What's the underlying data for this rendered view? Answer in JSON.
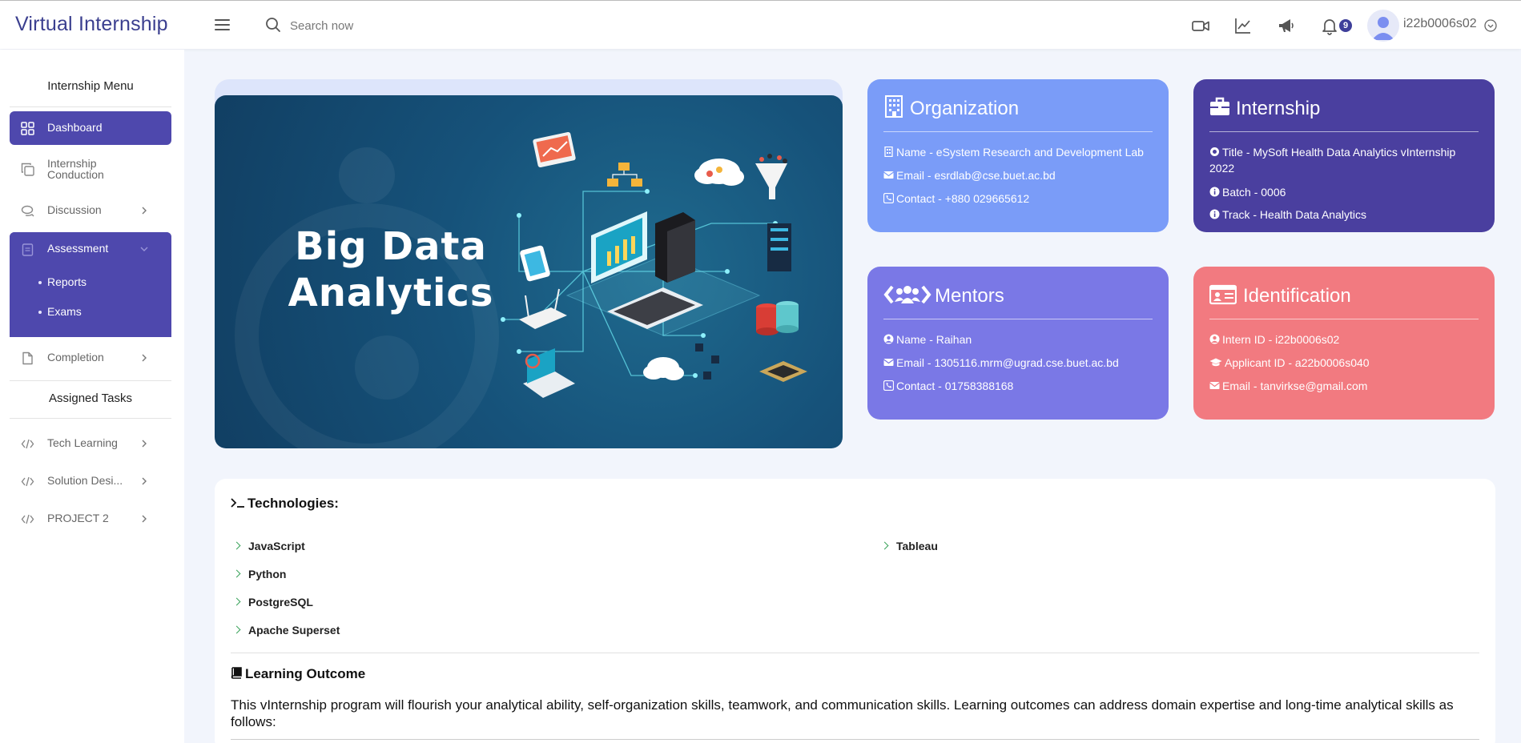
{
  "header": {
    "brand": "Virtual Internship",
    "search_placeholder": "Search now",
    "notification_count": "9",
    "username": "i22b0006s02",
    "icons": [
      "video-icon",
      "trend-chart-icon",
      "megaphone-icon",
      "bell-icon"
    ]
  },
  "sidebar": {
    "heading_menu": "Internship Menu",
    "heading_tasks": "Assigned Tasks",
    "items": [
      {
        "label": "Dashboard",
        "icon": "grid-icon"
      },
      {
        "label": "Internship Conduction",
        "icon": "copy-icon"
      },
      {
        "label": "Discussion",
        "icon": "chat-icon"
      },
      {
        "label": "Assessment",
        "icon": "clipboard-icon"
      },
      {
        "label": "Completion",
        "icon": "file-icon"
      }
    ],
    "assessment_sub": [
      "Reports",
      "Exams"
    ],
    "tasks": [
      {
        "label": "Tech Learning",
        "icon": "code-icon"
      },
      {
        "label": "Solution Desi...",
        "icon": "code-icon"
      },
      {
        "label": "PROJECT 2",
        "icon": "code-icon"
      }
    ]
  },
  "banner": {
    "title_line1": "Big Data",
    "title_line2": "Analytics"
  },
  "cards": {
    "organization": {
      "title": "Organization",
      "color": "#7a9cf8",
      "name": "Name - eSystem Research and Development Lab",
      "email": "Email - esrdlab@cse.buet.ac.bd",
      "contact": "Contact - +880 029665612"
    },
    "internship": {
      "title": "Internship",
      "color": "#4a3f9f",
      "title_line": "Title - MySoft Health Data Analytics vInternship 2022",
      "batch": "Batch - 0006",
      "track": "Track - Health Data Analytics"
    },
    "mentors": {
      "title": "Mentors",
      "color": "#7a78e6",
      "name": "Name - Raihan",
      "email": "Email - 1305116.mrm@ugrad.cse.buet.ac.bd",
      "contact": "Contact - 01758388168"
    },
    "identification": {
      "title": "Identification",
      "color": "#f27a80",
      "intern_id": "Intern ID - i22b0006s02",
      "applicant_id": "Applicant ID - a22b0006s040",
      "email": "Email - tanvirkse@gmail.com"
    }
  },
  "technologies": {
    "heading": "Technologies:",
    "left": [
      "JavaScript",
      "Python",
      "PostgreSQL",
      "Apache Superset"
    ],
    "right": [
      "Tableau"
    ]
  },
  "learning_outcome": {
    "heading": "Learning Outcome",
    "text": "This vInternship program will flourish your analytical ability, self-organization skills, teamwork, and communication skills. Learning outcomes can address domain expertise and long-time analytical skills as follows:"
  }
}
